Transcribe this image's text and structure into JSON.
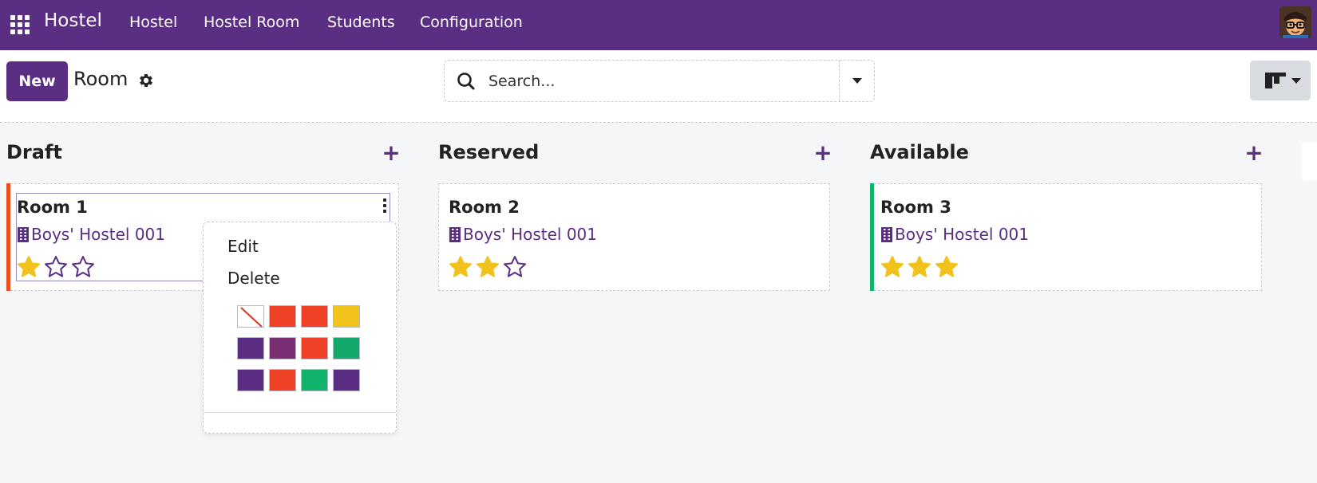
{
  "navbar": {
    "brand": "Hostel",
    "menu": [
      "Hostel",
      "Hostel Room",
      "Students",
      "Configuration"
    ]
  },
  "control_panel": {
    "new_label": "New",
    "title": "Room",
    "search_placeholder": "Search..."
  },
  "columns": [
    {
      "title": "Draft"
    },
    {
      "title": "Reserved"
    },
    {
      "title": "Available"
    }
  ],
  "cards": [
    {
      "name": "Room 1",
      "hostel": "Boys' Hostel 001",
      "rating": 1,
      "max_rating": 3,
      "accent": "#e8501e"
    },
    {
      "name": "Room 2",
      "hostel": "Boys' Hostel 001",
      "rating": 2,
      "max_rating": 3,
      "accent": ""
    },
    {
      "name": "Room 3",
      "hostel": "Boys' Hostel 001",
      "rating": 3,
      "max_rating": 3,
      "accent": "#12b36a"
    }
  ],
  "card_menu": {
    "edit_label": "Edit",
    "delete_label": "Delete",
    "colors": [
      "none",
      "#ef4125",
      "#ef4125",
      "#f1c31b",
      "#5b2d82",
      "#7a2e73",
      "#ef4125",
      "#12a96a",
      "#5b2d82",
      "#ef4125",
      "#12b36a",
      "#5b2d82"
    ]
  },
  "theme": {
    "primary": "#5a2e82",
    "star": "#f2c21c"
  }
}
